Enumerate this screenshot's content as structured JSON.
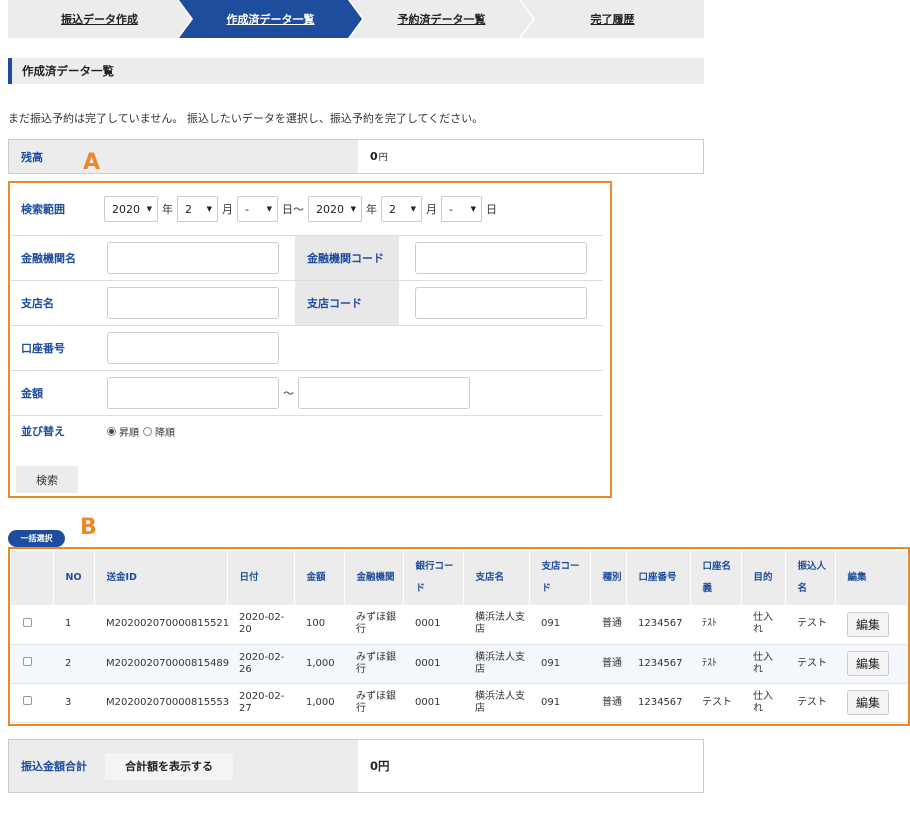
{
  "steps": [
    {
      "label": "振込データ作成"
    },
    {
      "label": "作成済データ一覧"
    },
    {
      "label": "予約済データ一覧"
    },
    {
      "label": "完了履歴"
    }
  ],
  "section_title": "作成済データ一覧",
  "notice": "まだ振込予約は完了していません。 振込したいデータを選択し、振込予約を完了してください。",
  "balance": {
    "label": "残高",
    "value": "0",
    "unit": "円"
  },
  "markers": {
    "a": "A",
    "b": "B"
  },
  "search": {
    "range_label": "検索範囲",
    "from_year": "2020",
    "from_month": "2",
    "from_day": "-",
    "to_year": "2020",
    "to_month": "2",
    "to_day": "-",
    "unit_year": "年",
    "unit_month": "月",
    "unit_day": "日",
    "tilde": "日〜",
    "bank_name_label": "金融機関名",
    "bank_code_label": "金融機関コード",
    "branch_name_label": "支店名",
    "branch_code_label": "支店コード",
    "account_label": "口座番号",
    "amount_label": "金額",
    "amount_tilde": "〜",
    "sort_label": "並び替え",
    "sort_asc": "昇順",
    "sort_desc": "降順",
    "button": "検索"
  },
  "select_all": "一括選択",
  "table": {
    "headers": [
      "",
      "NO",
      "送金ID",
      "日付",
      "金額",
      "金融機関",
      "銀行コード",
      "支店名",
      "支店コード",
      "種別",
      "口座番号",
      "口座名義",
      "目的",
      "振込人名",
      "編集"
    ],
    "rows": [
      {
        "no": "1",
        "id": "M202002070000815521",
        "date": "2020-02-20",
        "amount": "100",
        "bank": "みずほ銀行",
        "bank_code": "0001",
        "branch": "横浜法人支店",
        "branch_code": "091",
        "type": "普通",
        "account": "1234567",
        "holder": "ﾃｽﾄ",
        "purpose": "仕入れ",
        "sender": "テスト",
        "edit": "編集"
      },
      {
        "no": "2",
        "id": "M202002070000815489",
        "date": "2020-02-26",
        "amount": "1,000",
        "bank": "みずほ銀行",
        "bank_code": "0001",
        "branch": "横浜法人支店",
        "branch_code": "091",
        "type": "普通",
        "account": "1234567",
        "holder": "ﾃｽﾄ",
        "purpose": "仕入れ",
        "sender": "テスト",
        "edit": "編集"
      },
      {
        "no": "3",
        "id": "M202002070000815553",
        "date": "2020-02-27",
        "amount": "1,000",
        "bank": "みずほ銀行",
        "bank_code": "0001",
        "branch": "横浜法人支店",
        "branch_code": "091",
        "type": "普通",
        "account": "1234567",
        "holder": "テスト",
        "purpose": "仕入れ",
        "sender": "テスト",
        "edit": "編集"
      }
    ]
  },
  "total": {
    "label": "振込金額合計",
    "button": "合計額を表示する",
    "value": "0円"
  },
  "colors": {
    "accent": "#1f4d9d",
    "marker": "#e98a2a"
  }
}
